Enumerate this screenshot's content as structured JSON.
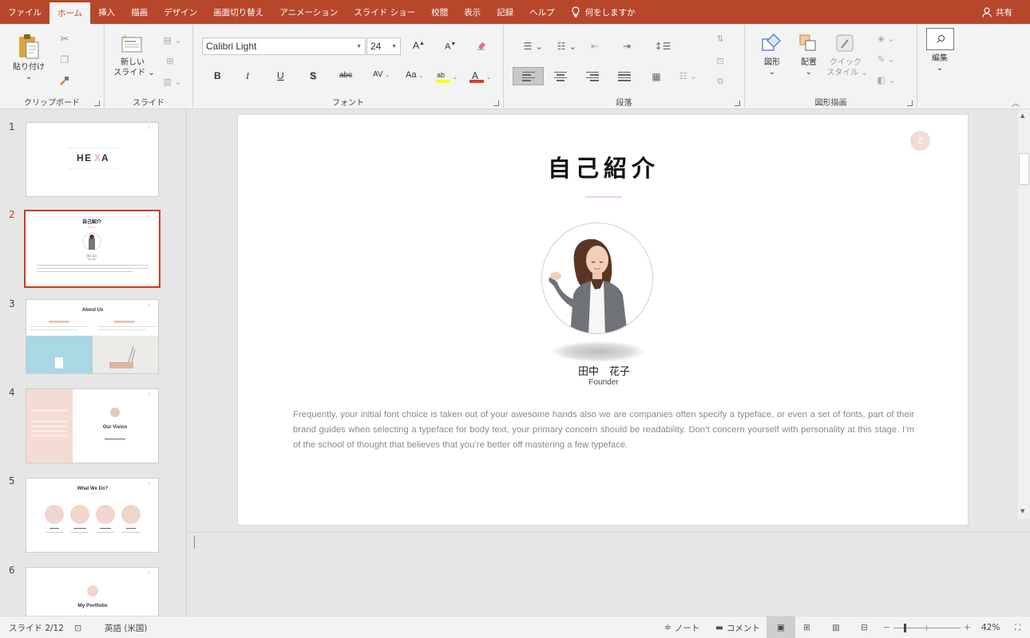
{
  "tabs": [
    "ファイル",
    "ホーム",
    "挿入",
    "描画",
    "デザイン",
    "画面切り替え",
    "アニメーション",
    "スライド ショー",
    "校閲",
    "表示",
    "記録",
    "ヘルプ"
  ],
  "tell_me": "何をしますか",
  "share": "共有",
  "ribbon": {
    "clipboard": {
      "paste": "貼り付け",
      "label": "クリップボード"
    },
    "slides": {
      "new_slide_1": "新しい",
      "new_slide_2": "スライド",
      "label": "スライド"
    },
    "font": {
      "name": "Calibri Light",
      "size": "24",
      "label": "フォント",
      "bold": "B",
      "italic": "I",
      "underline": "U",
      "shadow": "S",
      "strike": "abc",
      "spacing": "AV",
      "case": "Aa",
      "grow": "A",
      "shrink": "A"
    },
    "paragraph": {
      "label": "段落"
    },
    "drawing": {
      "shapes": "図形",
      "arrange": "配置",
      "quick_1": "クイック",
      "quick_2": "スタイル",
      "label": "図形描画"
    },
    "editing": {
      "label": "編集"
    }
  },
  "thumbnails": [
    {
      "num": "1",
      "title": "HEXA"
    },
    {
      "num": "2",
      "title": "自己紹介"
    },
    {
      "num": "3",
      "title": "About Us"
    },
    {
      "num": "4",
      "title": "Our Vision"
    },
    {
      "num": "5",
      "title": "What We Do?"
    },
    {
      "num": "6",
      "title": "My Portfolio"
    }
  ],
  "slide": {
    "page_number": "2",
    "title": "自己紹介",
    "name": "田中　花子",
    "role": "Founder",
    "body": "Frequently, your initial font choice is taken out of your awesome hands also we are companies often specify a typeface, or even a set of fonts,  part of their brand guides when selecting a typeface for body text, your primary concern should be readability. Don’t concern yourself with personality at this stage. I’m of the school of thought that believes that you’re better off mastering a few typeface."
  },
  "status": {
    "slide": "スライド 2/12",
    "language": "英語 (米国)",
    "notes": "ノート",
    "comments": "コメント",
    "zoom": "42%"
  },
  "colors": {
    "accent": "#b7472a",
    "slide_accent": "#e8c7bd"
  }
}
